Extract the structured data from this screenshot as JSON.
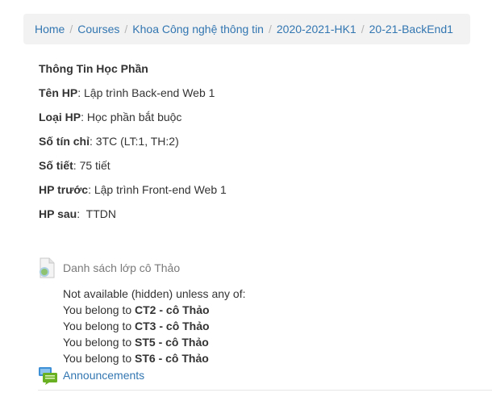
{
  "breadcrumb": {
    "items": [
      "Home",
      "Courses",
      "Khoa Công nghệ thông tin",
      "2020-2021-HK1",
      "20-21-BackEnd1"
    ],
    "separator": "/"
  },
  "course_info": {
    "heading": "Thông Tin Học Phần",
    "rows": [
      {
        "label": "Tên HP",
        "sep": ": ",
        "value": "Lập trình Back-end Web 1"
      },
      {
        "label": "Loại HP",
        "sep": ": ",
        "value": "Học phần bắt buộc"
      },
      {
        "label": "Số tín chỉ",
        "sep": ": ",
        "value": "3TC (LT:1, TH:2)"
      },
      {
        "label": "Số tiết",
        "sep": ": ",
        "value": "75 tiết"
      },
      {
        "label": "HP trước",
        "sep": ": ",
        "value": "Lập trình Front-end Web 1"
      },
      {
        "label": "HP sau",
        "sep": ":  ",
        "value": "TTDN"
      }
    ]
  },
  "activity": {
    "icon": "page-icon",
    "title": "Danh sách lớp cô Thảo",
    "restriction_intro": "Not available (hidden) unless any of:",
    "restriction_prefix": "You belong to",
    "groups": [
      "CT2 - cô Thảo",
      "CT3 - cô Thảo",
      "ST5 - cô Thảo",
      "ST6 - cô Thảo"
    ]
  },
  "announcements": {
    "icon": "forum-icon",
    "label": "Announcements"
  },
  "colors": {
    "link": "#3276b1",
    "breadcrumb_bg": "#f2f2f2",
    "muted": "#7a7a7a",
    "icon_green": "#7cba26"
  }
}
